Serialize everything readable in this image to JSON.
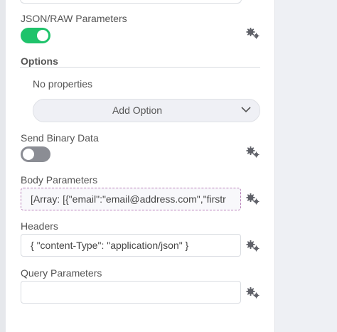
{
  "json_raw": {
    "label": "JSON/RAW Parameters",
    "enabled": true
  },
  "options": {
    "title": "Options",
    "empty_text": "No properties",
    "add_option_label": "Add Option"
  },
  "send_binary": {
    "label": "Send Binary Data",
    "enabled": false
  },
  "body_parameters": {
    "label": "Body Parameters",
    "value": "[Array: [{\"email\":\"email@address.com\",\"firstr"
  },
  "headers": {
    "label": "Headers",
    "value": "{ \"content-Type\": \"application/json\" }"
  },
  "query_parameters": {
    "label": "Query Parameters",
    "value": ""
  },
  "icons": {
    "settings": "gears-icon",
    "dropdown": "chevron-down-icon"
  },
  "colors": {
    "toggle_on": "#1fc36b",
    "toggle_off": "#8b8d94",
    "expression_border": "#b77db8"
  }
}
